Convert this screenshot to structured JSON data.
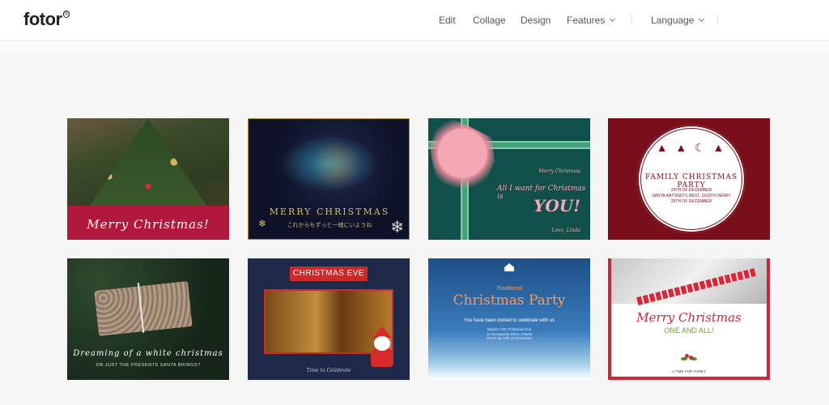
{
  "header": {
    "logo": "fotor",
    "logo_mark": "®",
    "nav": {
      "edit": "Edit",
      "collage": "Collage",
      "design": "Design",
      "features": "Features",
      "language": "Language"
    }
  },
  "cards": [
    {
      "title": "Merry Christmas!"
    },
    {
      "title": "MERRY CHRISTMAS",
      "subtitle": "これからもずっと一緒にいようね"
    },
    {
      "small": "Merry Christmas",
      "line1": "All I want for Christmas is",
      "line2": "YOU!",
      "footer": "Love, Linda"
    },
    {
      "title": "FAMILY CHRISTMAS PARTY",
      "line1": "24TH OF DECEMBER",
      "line2": "SANTA ANTONIO'S REST, SOUTH DERRY",
      "line3": "25TH OF DECEMBER"
    },
    {
      "title": "Dreaming of a white christmas",
      "subtitle": "OR JUST THE PRESENTS SANTA BRINGS?"
    },
    {
      "title": "CHRISTMAS EVE",
      "footer": "Time to Celebrate"
    },
    {
      "pre": "Traditional",
      "title": "Christmas Party",
      "line1": "You have been invited to celebrate with us",
      "line2": "Begins 7:00 Christmas Eve",
      "line3": "12 Snowpedia Drive, Atlanta",
      "line4": "RSVP by 10th of December"
    },
    {
      "title": "Merry Christmas",
      "subtitle": "ONE AND ALL!",
      "footer": "A TIME FOR FAMILY"
    }
  ],
  "colors": {
    "accent_red": "#b2183b",
    "teal": "#114f4b",
    "maroon": "#7a0f1c",
    "navy": "#1f2a4a"
  }
}
